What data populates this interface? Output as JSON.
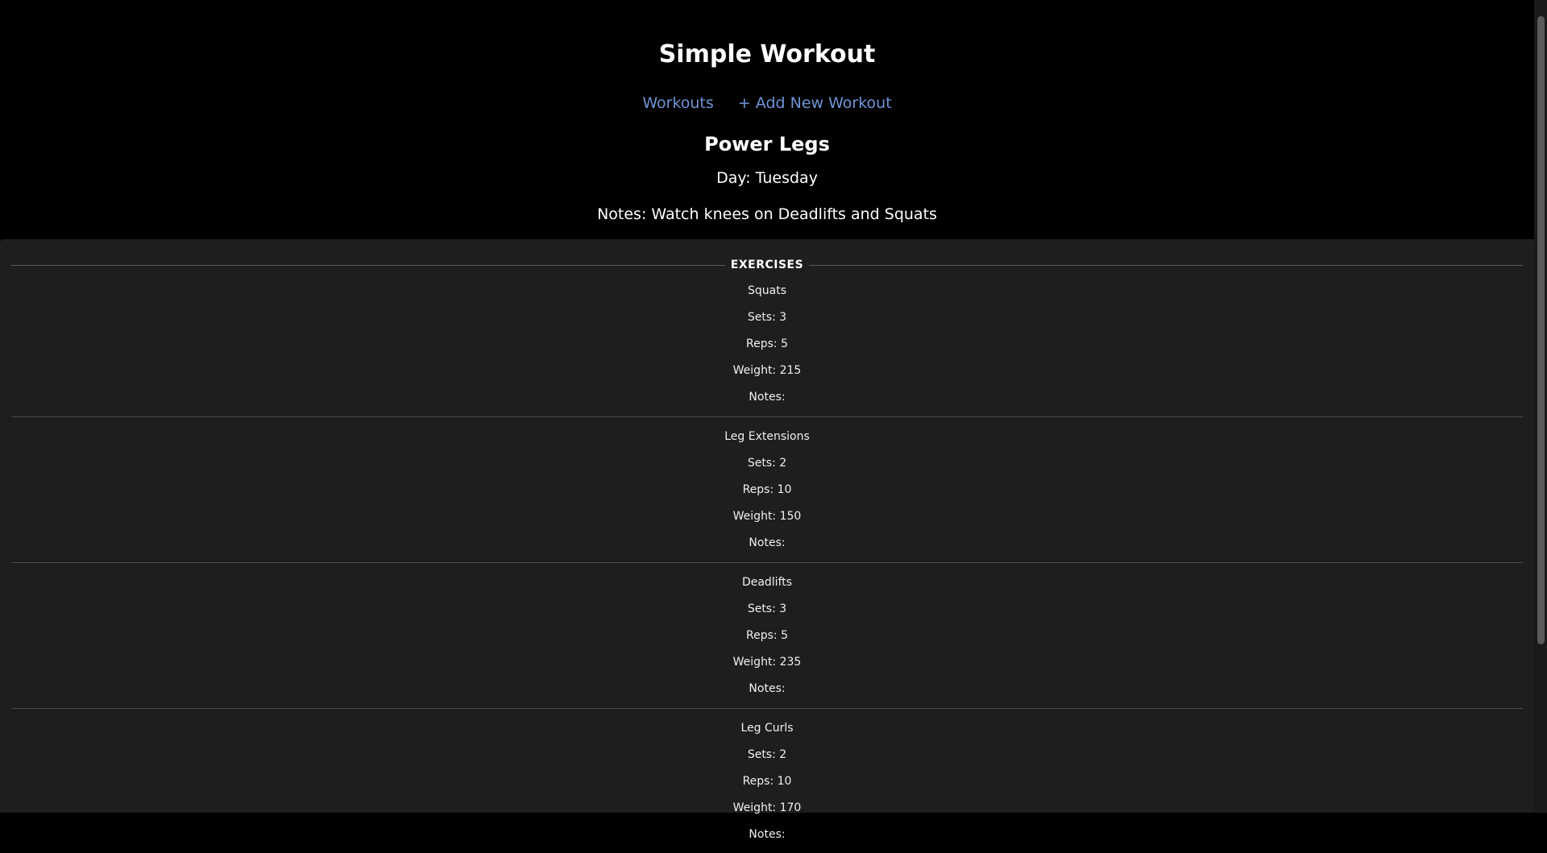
{
  "site": {
    "title": "Simple Workout"
  },
  "nav": {
    "workouts_label": "Workouts",
    "add_label": "+ Add New Workout"
  },
  "workout": {
    "name": "Power Legs",
    "day": "Day: Tuesday",
    "notes": "Notes: Watch knees on Deadlifts and Squats"
  },
  "exercises": {
    "legend": "EXERCISES",
    "items": [
      {
        "name": "Squats",
        "sets": "Sets: 3",
        "reps": "Reps: 5",
        "weight": "Weight: 215",
        "notes": "Notes:"
      },
      {
        "name": "Leg Extensions",
        "sets": "Sets: 2",
        "reps": "Reps: 10",
        "weight": "Weight: 150",
        "notes": "Notes:"
      },
      {
        "name": "Deadlifts",
        "sets": "Sets: 3",
        "reps": "Reps: 5",
        "weight": "Weight: 235",
        "notes": "Notes:"
      },
      {
        "name": "Leg Curls",
        "sets": "Sets: 2",
        "reps": "Reps: 10",
        "weight": "Weight: 170",
        "notes": "Notes:"
      }
    ]
  },
  "colors": {
    "link": "#6e94d6",
    "header_bg": "#000000",
    "content_bg": "#1e1e1e"
  }
}
